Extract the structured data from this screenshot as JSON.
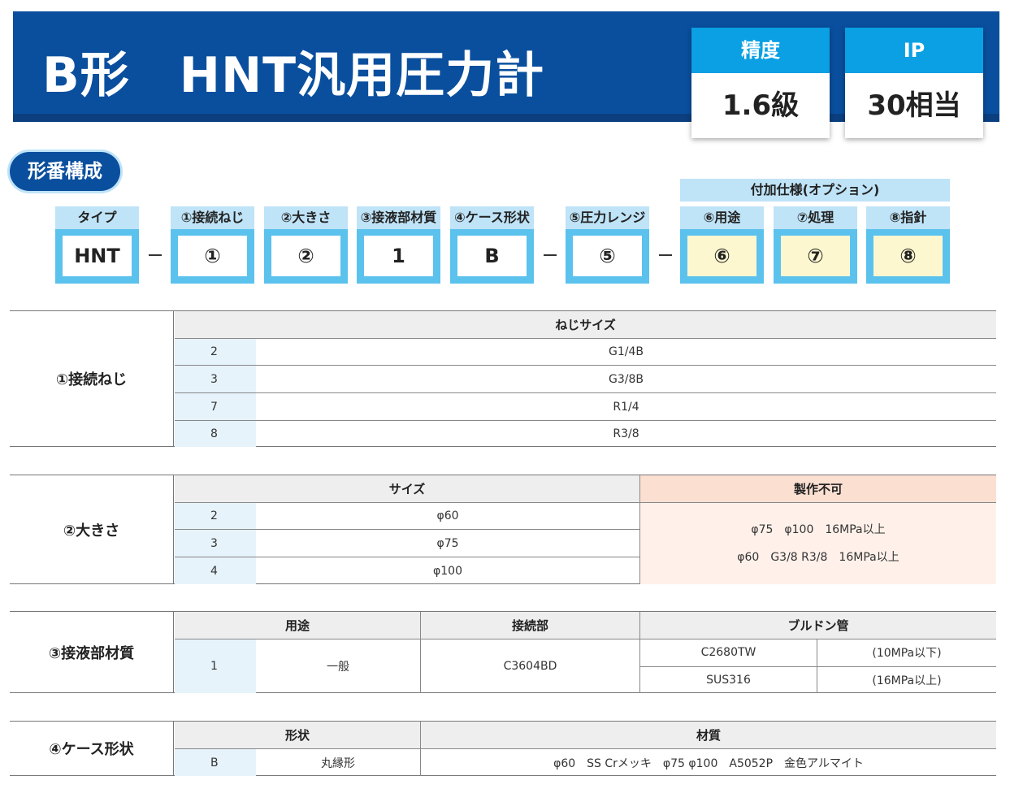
{
  "header": {
    "title": "B形　HNT汎用圧力計",
    "specs": [
      {
        "label": "精度",
        "value": "1.6級"
      },
      {
        "label": "IP",
        "value": "30相当"
      }
    ]
  },
  "section_pill": "形番構成",
  "model_code": {
    "option_header": "付加仕様(オプション)",
    "boxes": [
      {
        "label": "タイプ",
        "value": "HNT"
      },
      {
        "label": "①接続ねじ",
        "value": "①"
      },
      {
        "label": "②大きさ",
        "value": "②"
      },
      {
        "label": "③接液部材質",
        "value": "1"
      },
      {
        "label": "④ケース形状",
        "value": "B"
      },
      {
        "label": "⑤圧力レンジ",
        "value": "⑤"
      },
      {
        "label": "⑥用途",
        "value": "⑥"
      },
      {
        "label": "⑦処理",
        "value": "⑦"
      },
      {
        "label": "⑧指針",
        "value": "⑧"
      }
    ]
  },
  "table1": {
    "label": "①接続ねじ",
    "header": "ねじサイズ",
    "rows": [
      {
        "code": "2",
        "value": "G1/4B"
      },
      {
        "code": "3",
        "value": "G3/8B"
      },
      {
        "code": "7",
        "value": "R1/4"
      },
      {
        "code": "8",
        "value": "R3/8"
      }
    ]
  },
  "table2": {
    "label": "②大きさ",
    "header": "サイズ",
    "not_available_header": "製作不可",
    "rows": [
      {
        "code": "2",
        "value": "φ60"
      },
      {
        "code": "3",
        "value": "φ75"
      },
      {
        "code": "4",
        "value": "φ100"
      }
    ],
    "not_available": [
      "φ75　φ100　16MPa以上",
      "φ60　G3/8 R3/8　16MPa以上"
    ]
  },
  "table3": {
    "label": "③接液部材質",
    "headers": {
      "usage": "用途",
      "connection": "接続部",
      "bourdon": "ブルドン管"
    },
    "code": "1",
    "usage": "一般",
    "connection": "C3604BD",
    "bourdon": [
      {
        "material": "C2680TW",
        "condition": "(10MPa以下)"
      },
      {
        "material": "SUS316",
        "condition": "(16MPa以上)"
      }
    ]
  },
  "table4": {
    "label": "④ケース形状",
    "headers": {
      "shape": "形状",
      "material": "材質"
    },
    "code": "B",
    "shape": "丸縁形",
    "material": "φ60　SS Crメッキ　φ75 φ100　A5052P　金色アルマイト"
  },
  "colors": {
    "banner": "#0a4f9e",
    "spec_head": "#0aa0e3",
    "code_border": "#5bc2ee",
    "code_label": "#bfe3f7",
    "option_fill": "#fdf7d0",
    "not_available_head": "#fbe0d2"
  }
}
